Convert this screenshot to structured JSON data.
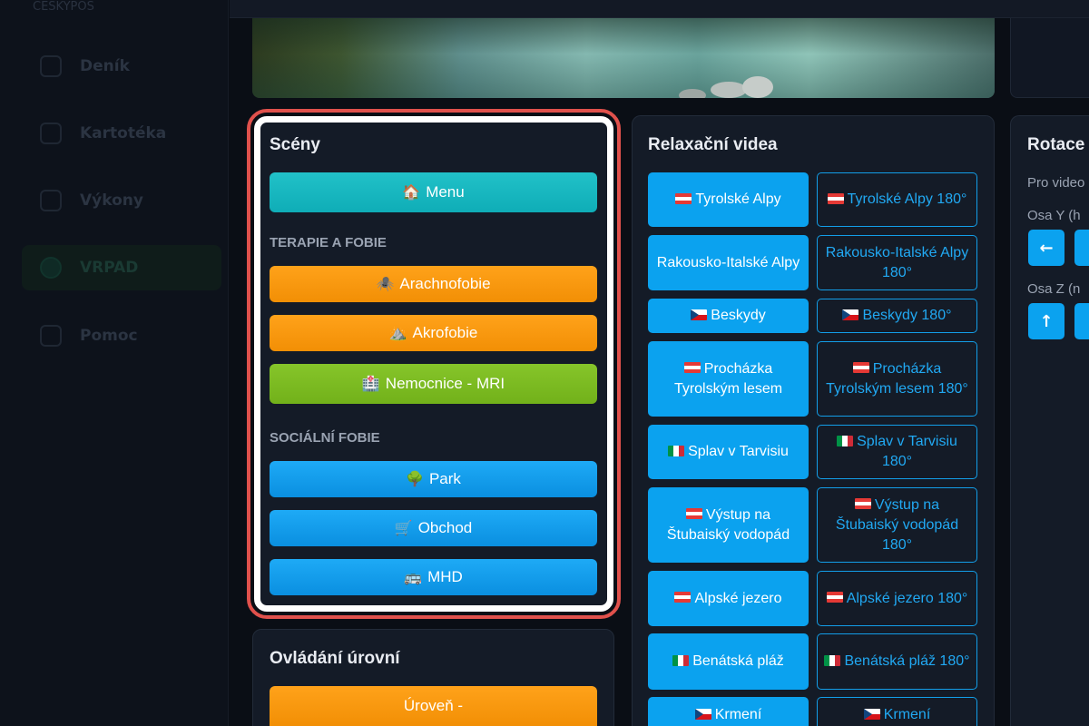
{
  "sidebar": {
    "brand": "CESKYPOS",
    "items": [
      {
        "label": "Deník",
        "icon": "chart-icon"
      },
      {
        "label": "Kartotéka",
        "icon": "folder-icon"
      },
      {
        "label": "Výkony",
        "icon": "list-icon"
      },
      {
        "label": "VRPAD",
        "icon": "vr-headset-icon",
        "active": true
      },
      {
        "label": "Pomoc",
        "icon": "help-icon"
      }
    ]
  },
  "scenes": {
    "title": "Scény",
    "menu": {
      "emoji": "🏠",
      "label": "Menu"
    },
    "therapy_label": "TERAPIE A FOBIE",
    "therapy": [
      {
        "emoji": "🕷️",
        "label": "Arachnofobie"
      },
      {
        "emoji": "⛰️",
        "label": "Akrofobie"
      },
      {
        "emoji": "🏥",
        "label": "Nemocnice - MRI"
      }
    ],
    "social_label": "SOCIÁLNÍ FOBIE",
    "social": [
      {
        "emoji": "🌳",
        "label": "Park"
      },
      {
        "emoji": "🛒",
        "label": "Obchod"
      },
      {
        "emoji": "🚌",
        "label": "MHD"
      }
    ]
  },
  "levels": {
    "title": "Ovládání úrovní",
    "decrease_label": "Úroveň -"
  },
  "videos": {
    "title": "Relaxační videa",
    "rows": [
      {
        "flag": "at",
        "left": "Tyrolské Alpy",
        "right": "Tyrolské Alpy 180°"
      },
      {
        "flag": "",
        "left": "Rakousko-Italské Alpy",
        "right": "Rakousko-Italské Alpy 180°"
      },
      {
        "flag": "cz",
        "left": "Beskydy",
        "right": "Beskydy 180°"
      },
      {
        "flag": "at",
        "left": "Procházka Tyrolským lesem",
        "right": "Procházka Tyrolským lesem 180°"
      },
      {
        "flag": "it",
        "left": "Splav v Tarvisiu",
        "right": "Splav v Tarvisiu 180°"
      },
      {
        "flag": "at",
        "left": "Výstup na Štubaiský vodopád",
        "right": "Výstup na Štubaiský vodopád 180°"
      },
      {
        "flag": "at",
        "left": "Alpské jezero",
        "right": "Alpské jezero 180°"
      },
      {
        "flag": "it",
        "left": "Benátská pláž",
        "right": "Benátská pláž 180°"
      },
      {
        "flag": "cz",
        "left": "Krmení",
        "right": "Krmení"
      }
    ]
  },
  "rotation": {
    "title": "Rotace",
    "subtitle": "Pro video",
    "axis_y": "Osa Y (h",
    "axis_z": "Osa Z (n",
    "left_arrow": "←",
    "up_arrow": "↑"
  }
}
